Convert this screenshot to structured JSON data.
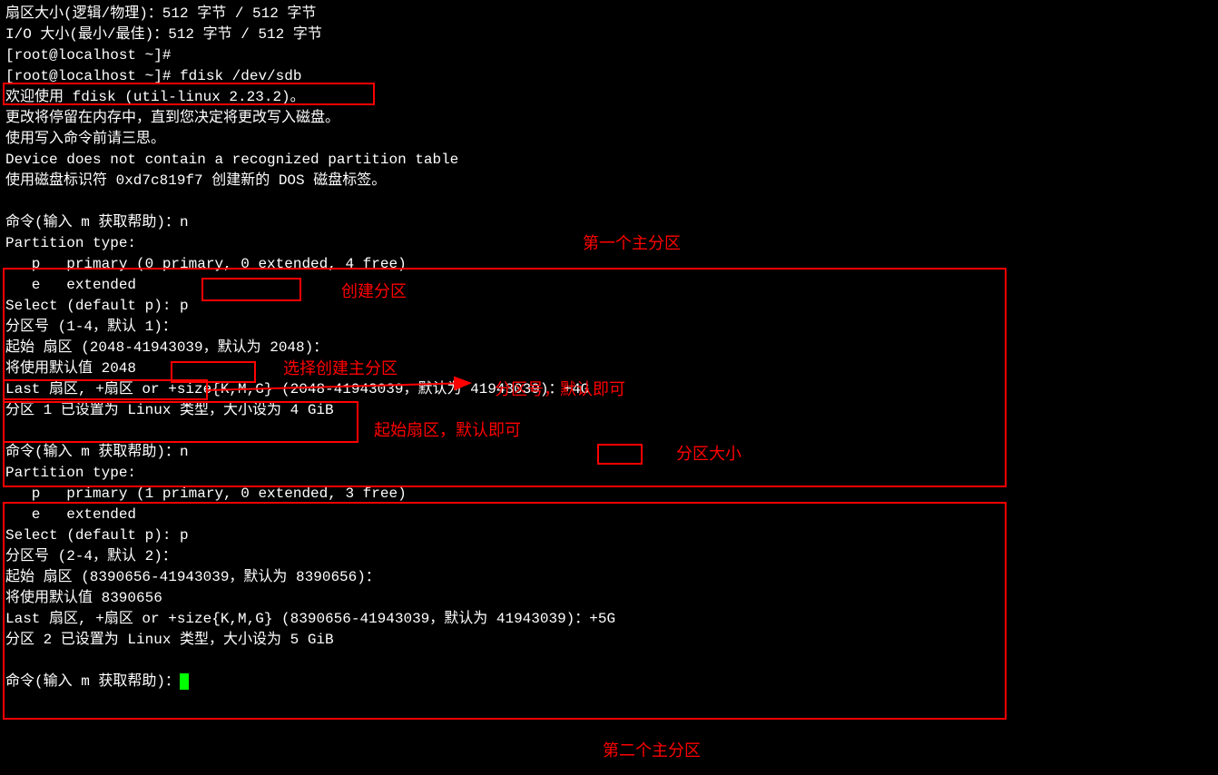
{
  "intro": {
    "l1": "扇区大小(逻辑/物理)：512 字节 / 512 字节",
    "l2": "I/O 大小(最小/最佳)：512 字节 / 512 字节",
    "l3": "",
    "l4": "[root@localhost ~]#",
    "l5": "[root@localhost ~]# fdisk /dev/sdb",
    "l6": "欢迎使用 fdisk (util-linux 2.23.2)。",
    "l7": "",
    "l8": "更改将停留在内存中，直到您决定将更改写入磁盘。",
    "l9": "使用写入命令前请三思。",
    "l10": "",
    "l11": "",
    "l12": "Device does not contain a recognized partition table",
    "l13": "使用磁盘标识符 0xd7c819f7 创建新的 DOS 磁盘标签。"
  },
  "part1": {
    "l1": "命令(输入 m 获取帮助)：n",
    "l2": "Partition type:",
    "l3": "   p   primary (0 primary, 0 extended, 4 free)",
    "l4": "   e   extended",
    "l5": "Select (default p): p",
    "l6": "分区号 (1-4，默认 1)：",
    "l7": "起始 扇区 (2048-41943039，默认为 2048)：",
    "l8": "将使用默认值 2048",
    "l9": "Last 扇区, +扇区 or +size{K,M,G} (2048-41943039，默认为 41943039)：+4G",
    "l10": "分区 1 已设置为 Linux 类型，大小设为 4 GiB"
  },
  "part2": {
    "l1": "命令(输入 m 获取帮助)：n",
    "l2": "Partition type:",
    "l3": "   p   primary (1 primary, 0 extended, 3 free)",
    "l4": "   e   extended",
    "l5": "Select (default p): p",
    "l6": "分区号 (2-4，默认 2)：",
    "l7": "起始 扇区 (8390656-41943039，默认为 8390656)：",
    "l8": "将使用默认值 8390656",
    "l9": "Last 扇区, +扇区 or +size{K,M,G} (8390656-41943039，默认为 41943039)：+5G",
    "l10": "分区 2 已设置为 Linux 类型，大小设为 5 GiB"
  },
  "prompt": {
    "final": "命令(输入 m 获取帮助)："
  },
  "labels": {
    "first_primary": "第一个主分区",
    "create_partition": "创建分区",
    "select_primary": "选择创建主分区",
    "partition_num": "分区号，默认即可",
    "start_sector": "起始扇区，默认即可",
    "partition_size": "分区大小",
    "second_primary": "第二个主分区"
  }
}
